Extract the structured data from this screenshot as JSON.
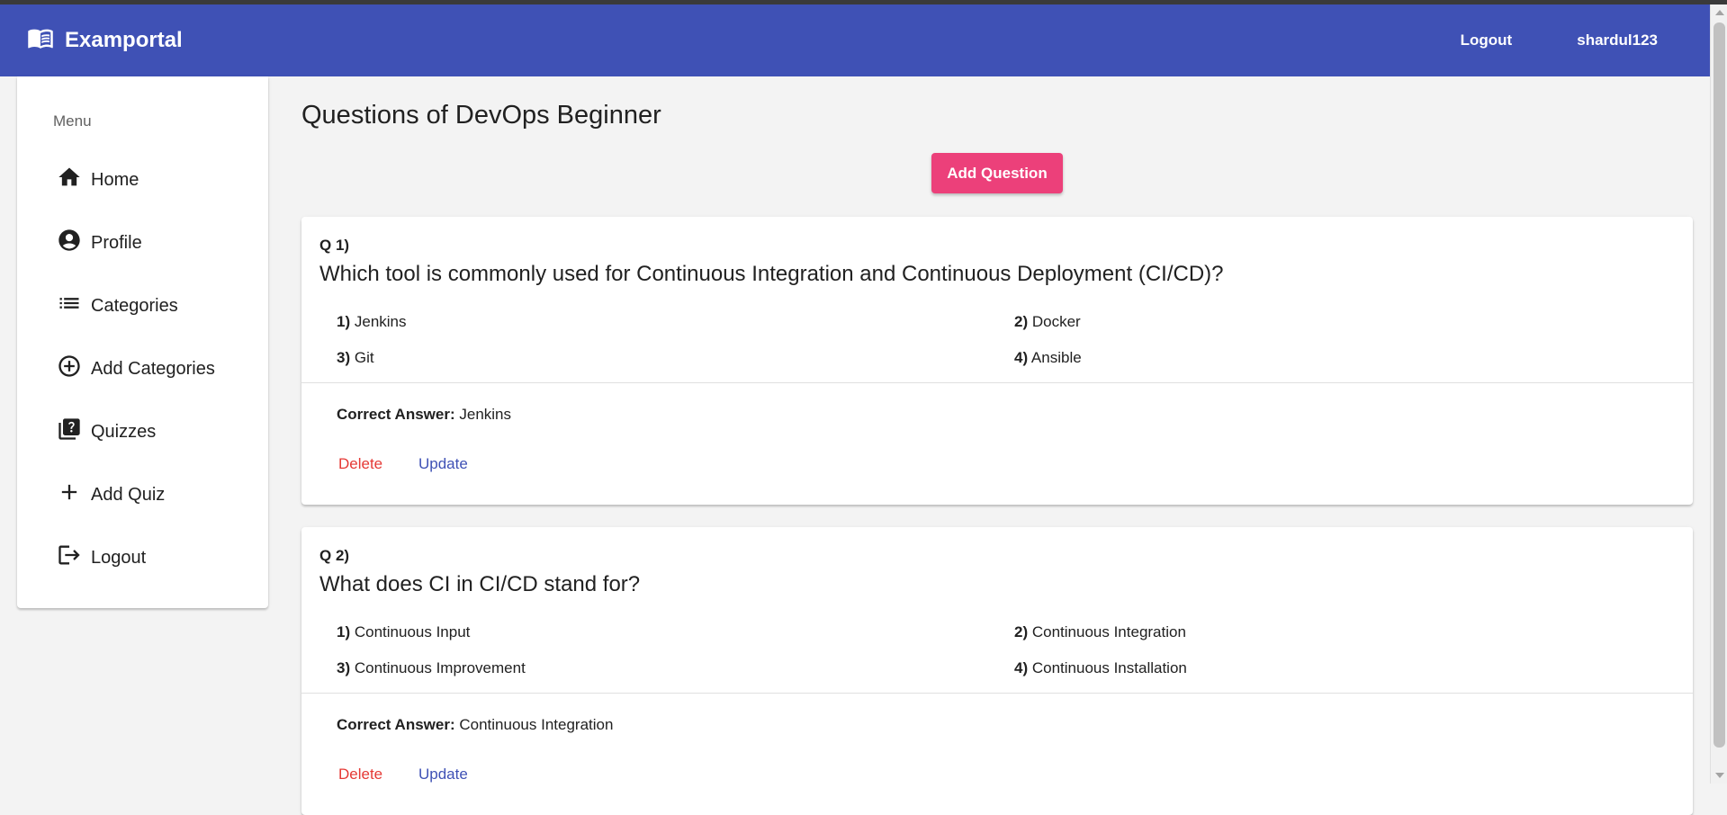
{
  "navbar": {
    "brand": "Examportal",
    "logout": "Logout",
    "username": "shardul123",
    "color": "#3f51b5"
  },
  "sidebar": {
    "title": "Menu",
    "items": [
      {
        "label": "Home",
        "icon": "home-icon"
      },
      {
        "label": "Profile",
        "icon": "account-circle-icon"
      },
      {
        "label": "Categories",
        "icon": "list-icon"
      },
      {
        "label": "Add Categories",
        "icon": "add-circle-outline-icon"
      },
      {
        "label": "Quizzes",
        "icon": "quiz-icon"
      },
      {
        "label": "Add Quiz",
        "icon": "add-icon"
      },
      {
        "label": "Logout",
        "icon": "logout-icon"
      }
    ]
  },
  "main": {
    "title": "Questions of DevOps Beginner",
    "add_button": "Add Question",
    "add_button_color": "#ec407a",
    "questions": [
      {
        "number": "Q 1)",
        "text": "Which tool is commonly used for Continuous Integration and Continuous Deployment (CI/CD)?",
        "options": [
          {
            "num": "1)",
            "text": "Jenkins"
          },
          {
            "num": "2)",
            "text": "Docker"
          },
          {
            "num": "3)",
            "text": "Git"
          },
          {
            "num": "4)",
            "text": "Ansible"
          }
        ],
        "answer_label": "Correct Answer:",
        "answer": "Jenkins",
        "delete": "Delete",
        "update": "Update"
      },
      {
        "number": "Q 2)",
        "text": "What does CI in CI/CD stand for?",
        "options": [
          {
            "num": "1)",
            "text": "Continuous Input"
          },
          {
            "num": "2)",
            "text": "Continuous Integration"
          },
          {
            "num": "3)",
            "text": "Continuous Improvement"
          },
          {
            "num": "4)",
            "text": "Continuous Installation"
          }
        ],
        "answer_label": "Correct Answer:",
        "answer": "Continuous Integration",
        "delete": "Delete",
        "update": "Update"
      }
    ]
  }
}
